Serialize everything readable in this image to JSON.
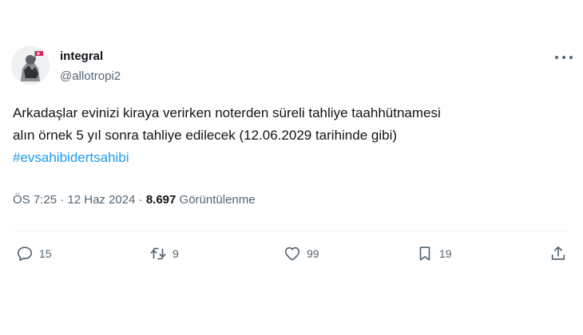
{
  "tweet": {
    "author": {
      "name": "integral",
      "handle": "@allotropi2"
    },
    "text_lines": [
      "Arkadaşlar evinizi kiraya verirken noterden süreli tahliye taahhütnamesi",
      "alın örnek 5 yıl sonra tahliye edilecek (12.06.2029 tarihinde gibi)"
    ],
    "hashtag": "#evsahibidertsahibi",
    "time": "ÖS 7:25",
    "separator": "·",
    "date": "12 Haz 2024",
    "views_count": "8.697",
    "views_label": "Görüntülenme"
  },
  "actions": {
    "replies": "15",
    "retweets": "9",
    "likes": "99",
    "bookmarks": "19"
  },
  "icons": [
    "more-icon",
    "reply-icon",
    "retweet-icon",
    "like-icon",
    "bookmark-icon",
    "share-icon"
  ],
  "colors": {
    "text": "#0f1419",
    "secondary": "#536471",
    "link": "#1d9bf0",
    "divider": "#eff3f4"
  }
}
